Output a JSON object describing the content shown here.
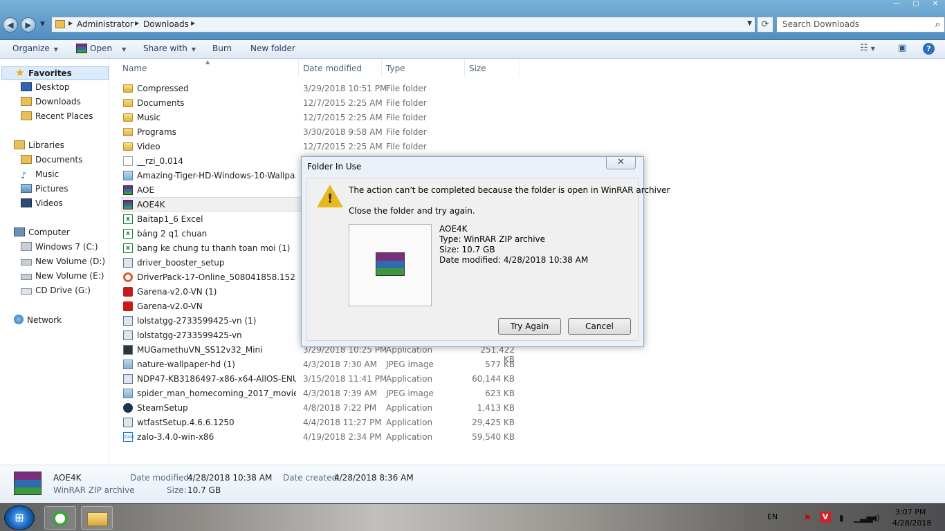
{
  "address": {
    "back_icon": "back-arrow-icon",
    "forward_icon": "forward-arrow-icon",
    "crumbs": [
      "Administrator",
      "Downloads"
    ],
    "search_placeholder": "Search Downloads"
  },
  "toolbar": {
    "organize": "Organize",
    "open": "Open",
    "share_with": "Share with",
    "burn": "Burn",
    "new_folder": "New folder"
  },
  "nav": {
    "favorites": "Favorites",
    "desktop": "Desktop",
    "downloads": "Downloads",
    "recent_places": "Recent Places",
    "libraries": "Libraries",
    "documents": "Documents",
    "music": "Music",
    "pictures": "Pictures",
    "videos": "Videos",
    "computer": "Computer",
    "drive_c": "Windows 7 (C:)",
    "drive_d": "New Volume (D:)",
    "drive_e": "New Volume (E:)",
    "drive_g": "CD Drive (G:)",
    "network": "Network"
  },
  "columns": {
    "name": "Name",
    "date_modified": "Date modified",
    "type": "Type",
    "size": "Size"
  },
  "files": [
    {
      "name": "Compressed",
      "date": "3/29/2018 10:51 PM",
      "type": "File folder",
      "size": "",
      "icon": "folder-icon"
    },
    {
      "name": "Documents",
      "date": "12/7/2015 2:25 AM",
      "type": "File folder",
      "size": "",
      "icon": "folder-icon"
    },
    {
      "name": "Music",
      "date": "12/7/2015 2:25 AM",
      "type": "File folder",
      "size": "",
      "icon": "folder-icon"
    },
    {
      "name": "Programs",
      "date": "3/30/2018 9:58 AM",
      "type": "File folder",
      "size": "",
      "icon": "folder-icon"
    },
    {
      "name": "Video",
      "date": "12/7/2015 2:25 AM",
      "type": "File folder",
      "size": "",
      "icon": "folder-icon"
    },
    {
      "name": "__rzi_0.014",
      "date": "",
      "type": "",
      "size": "",
      "icon": "file-icon"
    },
    {
      "name": "Amazing-Tiger-HD-Windows-10-Wallpa...",
      "date": "",
      "type": "",
      "size": "",
      "icon": "image-icon"
    },
    {
      "name": "AOE",
      "date": "",
      "type": "",
      "size": "",
      "icon": "winrar-icon"
    },
    {
      "name": "AOE4K",
      "date": "",
      "type": "",
      "size": "",
      "icon": "winrar-icon"
    },
    {
      "name": "Baitap1_6 Excel",
      "date": "",
      "type": "",
      "size": "",
      "icon": "excel-icon"
    },
    {
      "name": "bảng 2 q1 chuan",
      "date": "",
      "type": "",
      "size": "",
      "icon": "excel-icon"
    },
    {
      "name": "bang ke chung tu thanh toan moi (1)",
      "date": "",
      "type": "",
      "size": "",
      "icon": "excel-icon"
    },
    {
      "name": "driver_booster_setup",
      "date": "",
      "type": "",
      "size": "",
      "icon": "installer-icon"
    },
    {
      "name": "DriverPack-17-Online_508041858.1523043...",
      "date": "",
      "type": "",
      "size": "",
      "icon": "driverpack-icon"
    },
    {
      "name": "Garena-v2.0-VN (1)",
      "date": "",
      "type": "",
      "size": "",
      "icon": "garena-icon"
    },
    {
      "name": "Garena-v2.0-VN",
      "date": "",
      "type": "",
      "size": "",
      "icon": "garena-icon"
    },
    {
      "name": "lolstatgg-2733599425-vn (1)",
      "date": "",
      "type": "",
      "size": "",
      "icon": "installer-icon"
    },
    {
      "name": "lolstatgg-2733599425-vn",
      "date": "",
      "type": "",
      "size": "",
      "icon": "installer-icon"
    },
    {
      "name": "MUGamethuVN_SS12v32_Mini",
      "date": "3/29/2018 10:25 PM",
      "type": "Application",
      "size": "251,422 KB",
      "icon": "application-icon"
    },
    {
      "name": "nature-wallpaper-hd (1)",
      "date": "4/3/2018 7:30 AM",
      "type": "JPEG image",
      "size": "577 KB",
      "icon": "image-icon"
    },
    {
      "name": "NDP47-KB3186497-x86-x64-AllOS-ENU",
      "date": "3/15/2018 11:41 PM",
      "type": "Application",
      "size": "60,144 KB",
      "icon": "installer-icon"
    },
    {
      "name": "spider_man_homecoming_2017_movie_4...",
      "date": "4/3/2018 7:39 AM",
      "type": "JPEG image",
      "size": "623 KB",
      "icon": "image-icon"
    },
    {
      "name": "SteamSetup",
      "date": "4/8/2018 7:22 PM",
      "type": "Application",
      "size": "1,413 KB",
      "icon": "steam-icon"
    },
    {
      "name": "wtfastSetup.4.6.6.1250",
      "date": "4/4/2018 11:27 PM",
      "type": "Application",
      "size": "29,425 KB",
      "icon": "installer-icon"
    },
    {
      "name": "zalo-3.4.0-win-x86",
      "date": "4/19/2018 2:34 PM",
      "type": "Application",
      "size": "59,540 KB",
      "icon": "zalo-icon"
    }
  ],
  "details": {
    "name": "AOE4K",
    "type": "WinRAR ZIP archive",
    "date_modified_label": "Date modified:",
    "date_modified": "4/28/2018 10:38 AM",
    "date_created_label": "Date created:",
    "date_created": "4/28/2018 8:36 AM",
    "size_label": "Size:",
    "size": "10.7 GB"
  },
  "dialog": {
    "title": "Folder In Use",
    "close": "✕",
    "message": "The action can't be completed because the folder is open in WinRAR archiver",
    "instruction": "Close the folder and try again.",
    "file_name": "AOE4K",
    "file_type": "Type: WinRAR ZIP archive",
    "file_size": "Size: 10.7 GB",
    "file_date": "Date modified: 4/28/2018 10:38 AM",
    "try_again": "Try Again",
    "cancel": "Cancel"
  },
  "taskbar": {
    "language": "EN",
    "time": "3:07 PM",
    "date": "4/28/2018"
  }
}
